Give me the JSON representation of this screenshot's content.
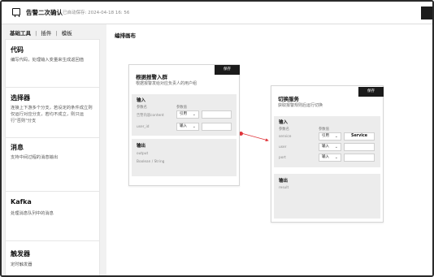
{
  "header": {
    "title": "告警二次确认",
    "saved_text": "已自动保存: 2024-04-18 16: 56"
  },
  "sidebar": {
    "tabs": [
      {
        "label": "基础工具",
        "active": true
      },
      {
        "label": "插件",
        "active": false
      },
      {
        "label": "模板",
        "active": false
      }
    ],
    "separator": "|",
    "items": [
      {
        "title": "代码",
        "desc": "编写代码，处理输入变量来生成返回值"
      },
      {
        "title": "选择器",
        "desc": "连接上下游多个分支，若设定的条件成立则仅运行对应分支，若均不成立，则只运行\"否则\"分支"
      },
      {
        "title": "消息",
        "desc": "支持中间过程的消息输出"
      },
      {
        "title": "Kafka",
        "desc": "处理消息队列中的消息"
      },
      {
        "title": "触发器",
        "desc": "定时触发器"
      }
    ]
  },
  "canvas": {
    "title": "编排画布",
    "node1": {
      "title": "根据报警入群",
      "desc": "根据报警发给对应负责人的用户组",
      "action": "保存",
      "input": {
        "title": "输入",
        "col_name": "参数名",
        "col_value": "参数值",
        "rows": [
          {
            "name": "告警内容content",
            "type": "引用"
          },
          {
            "name": "user_id",
            "type": "输入"
          }
        ]
      },
      "output": {
        "title": "输出",
        "rows": [
          "output",
          "Boolean / String"
        ]
      }
    },
    "node2": {
      "title": "切换服务",
      "desc": "获取报警规则后运行切换",
      "action": "保存",
      "input": {
        "title": "输入",
        "col_name": "参数名",
        "col_value": "参数值",
        "rows": [
          {
            "name": "service",
            "type": "引用",
            "value": "Service"
          },
          {
            "name": "user",
            "type": "输入",
            "value": ""
          },
          {
            "name": "port",
            "type": "输入",
            "value": ""
          }
        ]
      },
      "output": {
        "title": "输出",
        "rows": [
          "result"
        ]
      }
    },
    "colors": {
      "connector": "#e0353b",
      "node_button": "#1b1b1b"
    }
  }
}
